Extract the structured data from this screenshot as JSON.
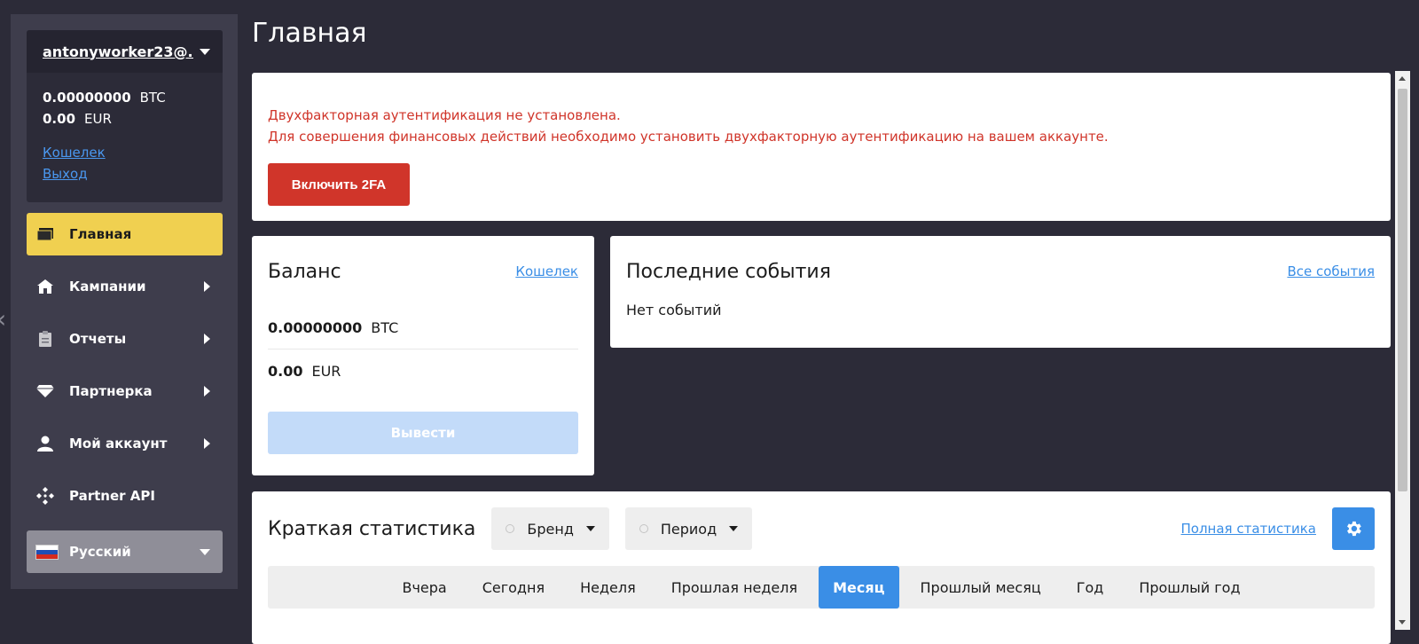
{
  "sidebar": {
    "user": {
      "email": "antonyworker23@...",
      "balances": [
        {
          "amount": "0.00000000",
          "currency": "BTC"
        },
        {
          "amount": "0.00",
          "currency": "EUR"
        }
      ],
      "links": [
        "Кошелек",
        "Выход"
      ]
    },
    "nav": [
      {
        "label": "Главная",
        "icon": "wallet-icon",
        "active": true
      },
      {
        "label": "Кампании",
        "icon": "home-icon"
      },
      {
        "label": "Отчеты",
        "icon": "clipboard-icon"
      },
      {
        "label": "Партнерка",
        "icon": "diamond-icon"
      },
      {
        "label": "Мой аккаунт",
        "icon": "user-icon"
      },
      {
        "label": "Partner API",
        "icon": "api-icon"
      }
    ],
    "language": {
      "label": "Русский",
      "icon": "russian-flag-icon"
    }
  },
  "page": {
    "title": "Главная"
  },
  "alert": {
    "line1": "Двухфакторная аутентификация не установлена.",
    "line2": "Для совершения финансовых действий необходимо установить двухфакторную аутентификацию на вашем аккаунте.",
    "button": "Включить 2FA"
  },
  "balance": {
    "title": "Баланс",
    "link": "Кошелек",
    "rows": [
      {
        "amount": "0.00000000",
        "currency": "BTC"
      },
      {
        "amount": "0.00",
        "currency": "EUR"
      }
    ],
    "withdraw": "Вывести"
  },
  "events": {
    "title": "Последние события",
    "link": "Все события",
    "empty": "Нет событий"
  },
  "stats": {
    "title": "Краткая статистика",
    "brand": "Бренд",
    "period": "Период",
    "full_link": "Полная статистика",
    "tabs": [
      "Вчера",
      "Сегодня",
      "Неделя",
      "Прошлая неделя",
      "Месяц",
      "Прошлый месяц",
      "Год",
      "Прошлый год"
    ],
    "active_tab": 4
  },
  "colors": {
    "background": "#2c2b38",
    "sidebar": "#3e3d4c",
    "active_nav": "#f0d050",
    "alert_red": "#d0352a",
    "accent_blue": "#3a8ee6"
  }
}
